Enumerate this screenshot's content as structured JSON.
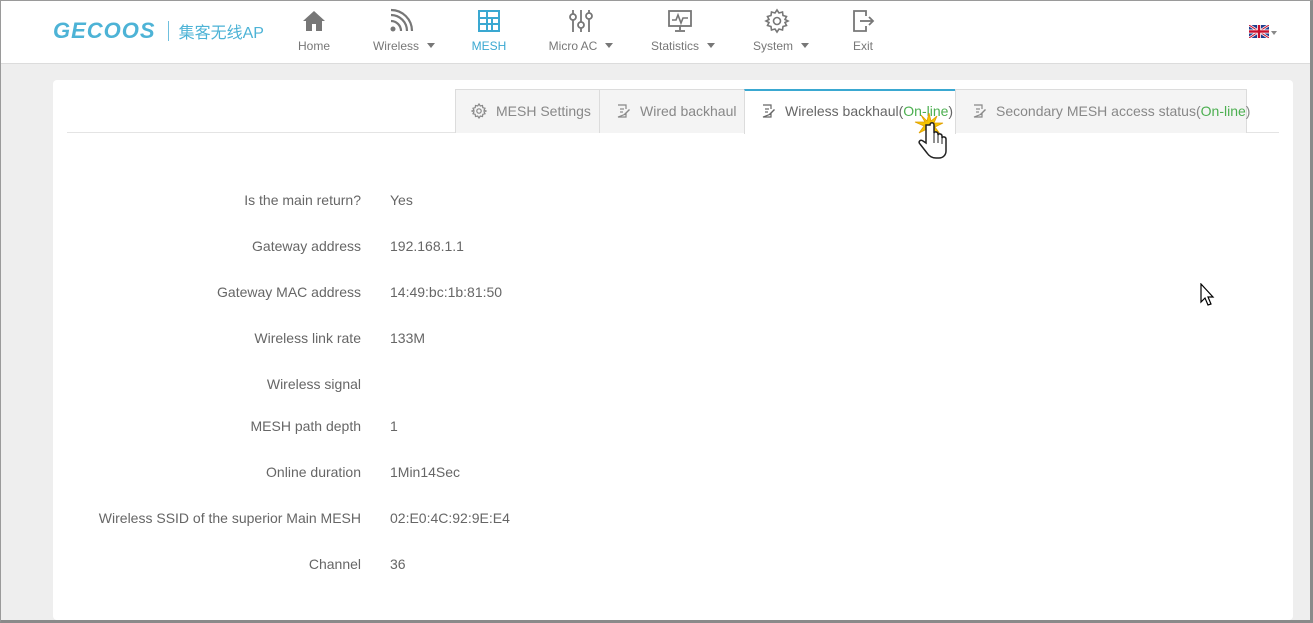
{
  "brand": {
    "logo": "GECOOS",
    "subtitle": "集客无线AP"
  },
  "nav": [
    {
      "label": "Home",
      "icon": "home-icon",
      "dropdown": false
    },
    {
      "label": "Wireless",
      "icon": "wifi-icon",
      "dropdown": true
    },
    {
      "label": "MESH",
      "icon": "mesh-grid-icon",
      "dropdown": false,
      "active": true
    },
    {
      "label": "Micro AC",
      "icon": "sliders-icon",
      "dropdown": true
    },
    {
      "label": "Statistics",
      "icon": "monitor-chart-icon",
      "dropdown": true
    },
    {
      "label": "System",
      "icon": "gear-icon",
      "dropdown": true
    },
    {
      "label": "Exit",
      "icon": "exit-icon",
      "dropdown": false
    }
  ],
  "language": {
    "icon": "uk-flag-icon"
  },
  "tabs": [
    {
      "label": "MESH Settings",
      "icon": "gear-icon",
      "status": ""
    },
    {
      "label": "Wired backhaul",
      "icon": "edit-doc-icon",
      "status": ""
    },
    {
      "label": "Wireless backhaul",
      "icon": "edit-doc-icon",
      "status": "On-line",
      "active": true
    },
    {
      "label": "Secondary MESH access status",
      "icon": "edit-doc-icon",
      "status": "On-line"
    }
  ],
  "details": [
    {
      "label": "Is the main return?",
      "value": "Yes"
    },
    {
      "label": "Gateway address",
      "value": "192.168.1.1"
    },
    {
      "label": "Gateway MAC address",
      "value": "14:49:bc:1b:81:50"
    },
    {
      "label": "Wireless link rate",
      "value": "133M"
    },
    {
      "label": "Wireless signal",
      "value": ""
    },
    {
      "label": "MESH path depth",
      "value": "1"
    },
    {
      "label": "Online duration",
      "value": "1Min14Sec"
    },
    {
      "label": "Wireless SSID of the superior Main MESH",
      "value": "02:E0:4C:92:9E:E4"
    },
    {
      "label": "Channel",
      "value": "36"
    }
  ],
  "colors": {
    "accent": "#3aa8d1",
    "brand": "#4db3d6",
    "online": "#4caf50"
  }
}
